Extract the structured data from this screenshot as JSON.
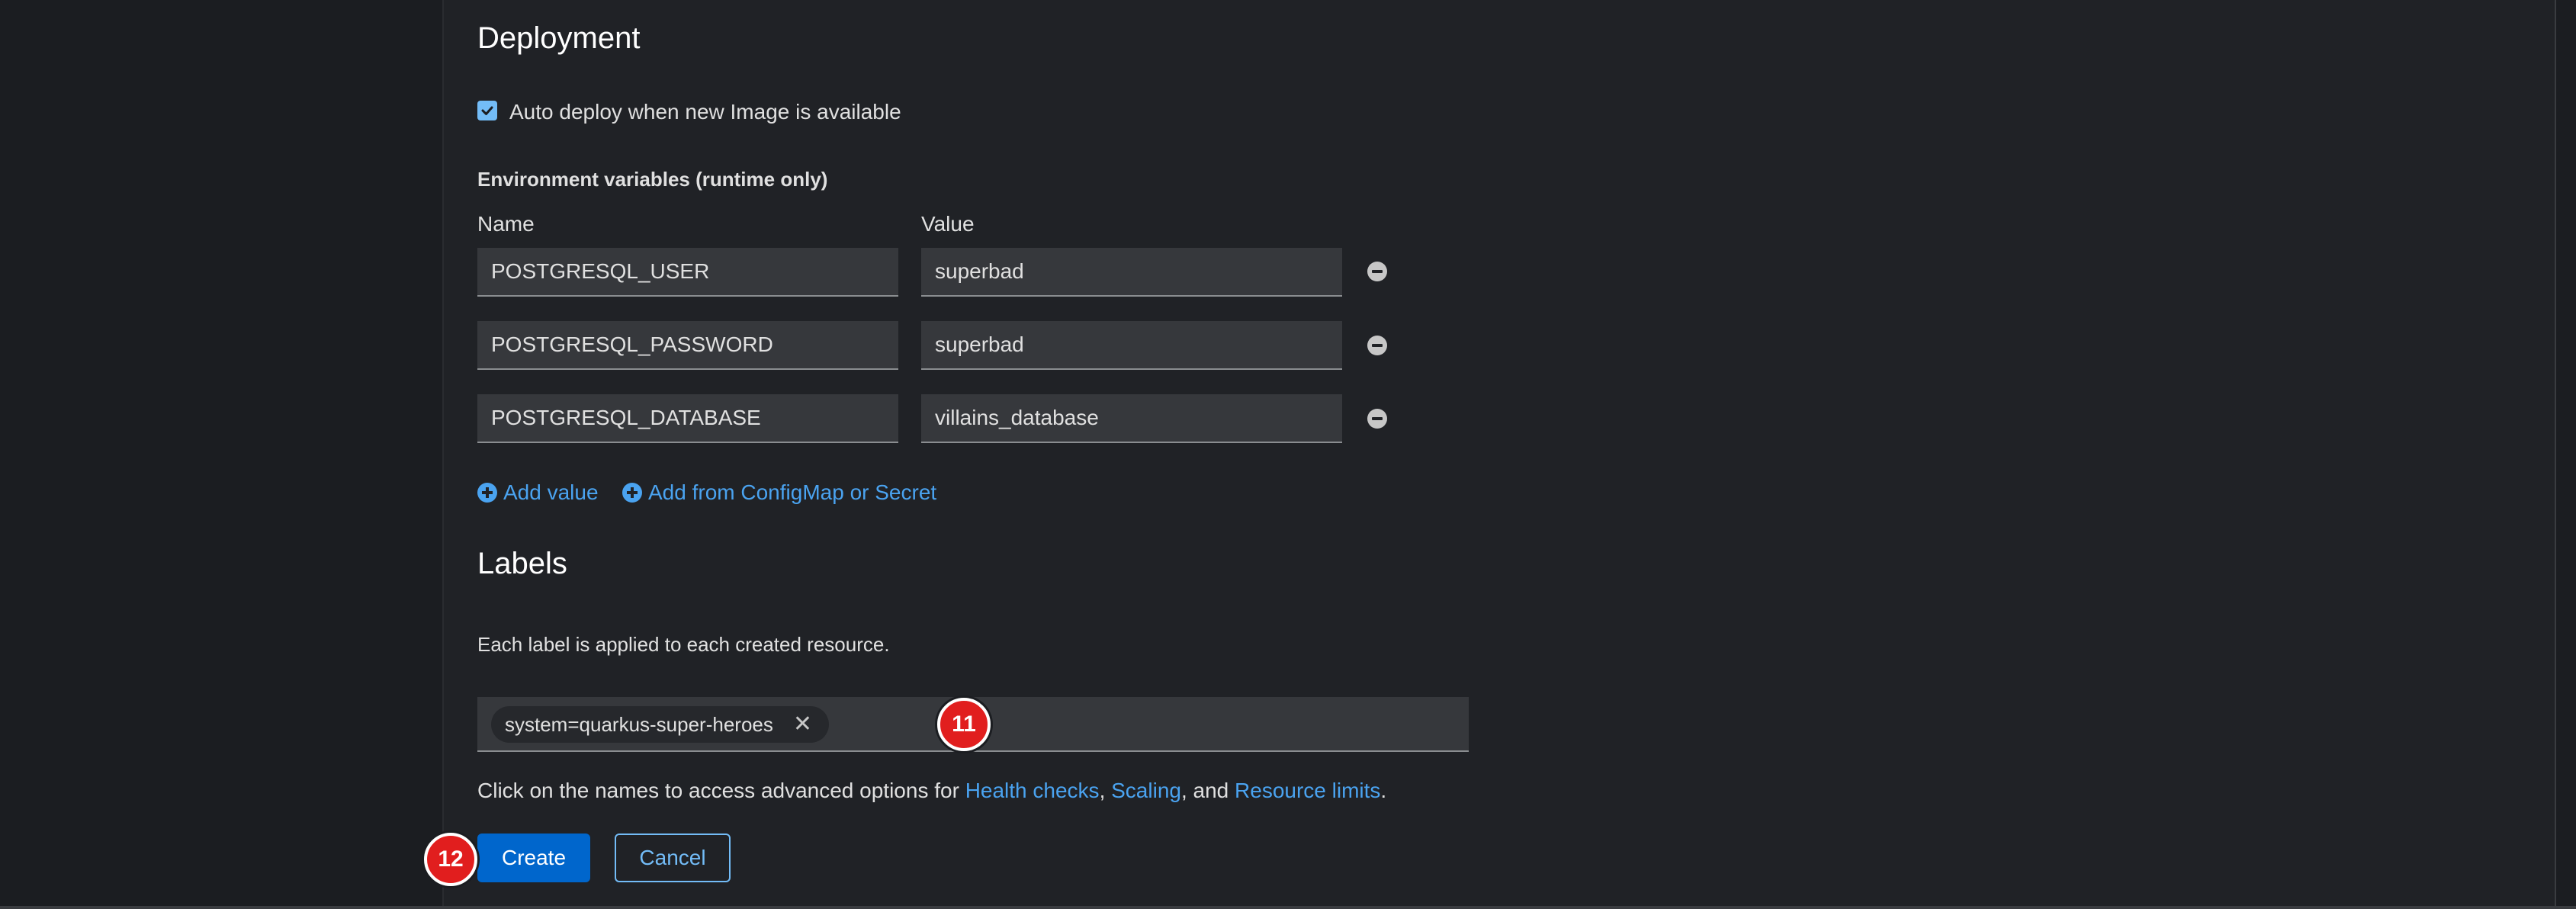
{
  "deployment": {
    "title": "Deployment",
    "auto_deploy_label": "Auto deploy when new Image is available",
    "auto_deploy_checked": true
  },
  "env": {
    "section_label": "Environment variables (runtime only)",
    "name_header": "Name",
    "value_header": "Value",
    "rows": [
      {
        "name": "POSTGRESQL_USER",
        "value": "superbad"
      },
      {
        "name": "POSTGRESQL_PASSWORD",
        "value": "superbad"
      },
      {
        "name": "POSTGRESQL_DATABASE",
        "value": "villains_database"
      }
    ],
    "add_value_label": "Add value",
    "add_from_label": "Add from ConfigMap or Secret"
  },
  "labels": {
    "title": "Labels",
    "help_text": "Each label is applied to each created resource.",
    "chips": [
      "system=quarkus-super-heroes"
    ],
    "chip_close": "✕"
  },
  "advanced": {
    "prefix": "Click on the names to access advanced options for ",
    "health_checks": "Health checks",
    "comma": ",",
    "scaling": "Scaling",
    "and_text": ", and ",
    "resource_limits": "Resource limits",
    "period": "."
  },
  "actions": {
    "create_label": "Create",
    "cancel_label": "Cancel"
  },
  "badges": {
    "step_11": "11",
    "step_12": "12"
  },
  "colors": {
    "accent": "#0066cc",
    "link": "#4aa3f0",
    "badge": "#e11e1e"
  }
}
